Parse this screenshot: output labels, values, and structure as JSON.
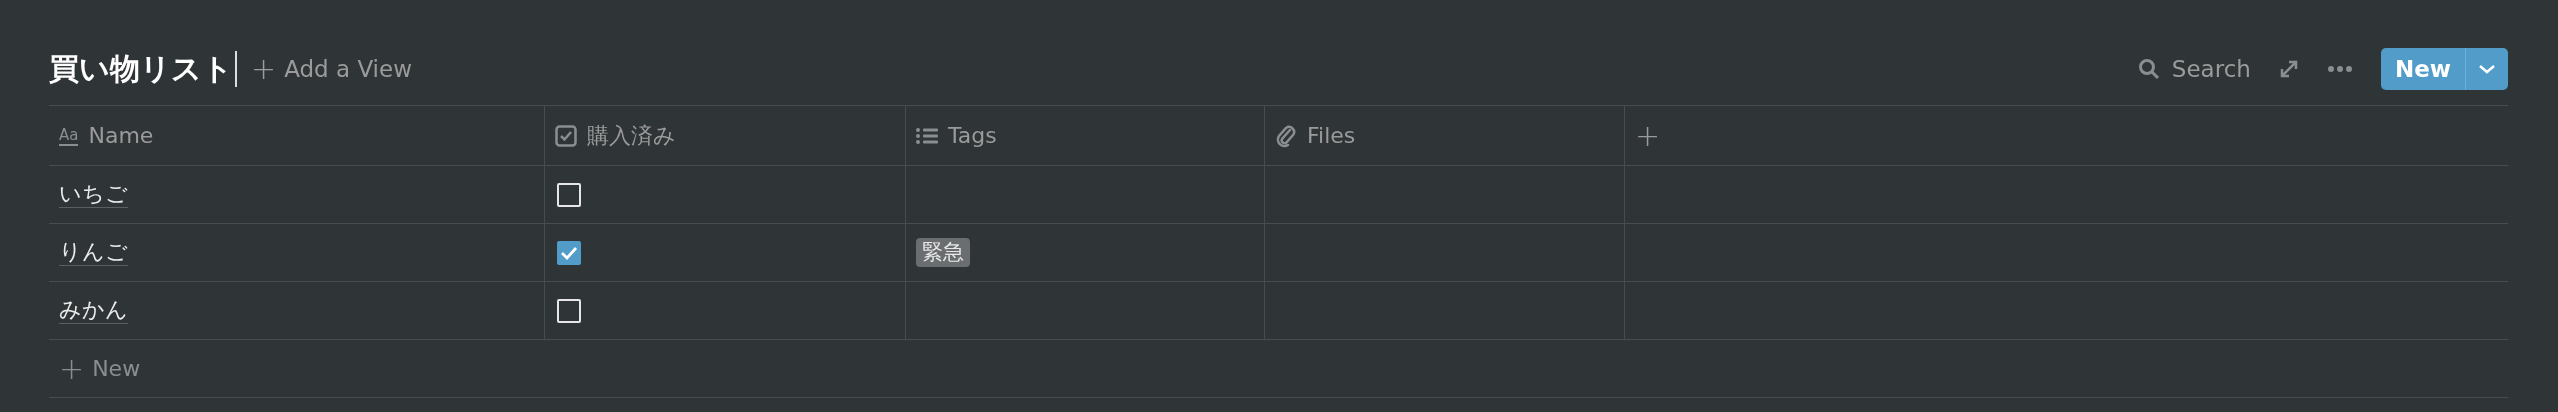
{
  "title": "買い物リスト",
  "add_view": {
    "icon": "+",
    "label": "Add a View"
  },
  "toolbar": {
    "search": "Search",
    "new_button": "New"
  },
  "table": {
    "columns": [
      {
        "kind": "title",
        "label": "Name",
        "icon_text": "Aa"
      },
      {
        "kind": "checkbox",
        "label": "購入済み"
      },
      {
        "kind": "multi_select",
        "label": "Tags"
      },
      {
        "kind": "files",
        "label": "Files"
      }
    ],
    "add_column": "+",
    "rows": [
      {
        "name": "いちご",
        "checked": false,
        "tags": []
      },
      {
        "name": "りんご",
        "checked": true,
        "tags": [
          "緊急"
        ]
      },
      {
        "name": "みかん",
        "checked": false,
        "tags": []
      }
    ],
    "new_row": {
      "icon": "+",
      "label": "New"
    }
  }
}
